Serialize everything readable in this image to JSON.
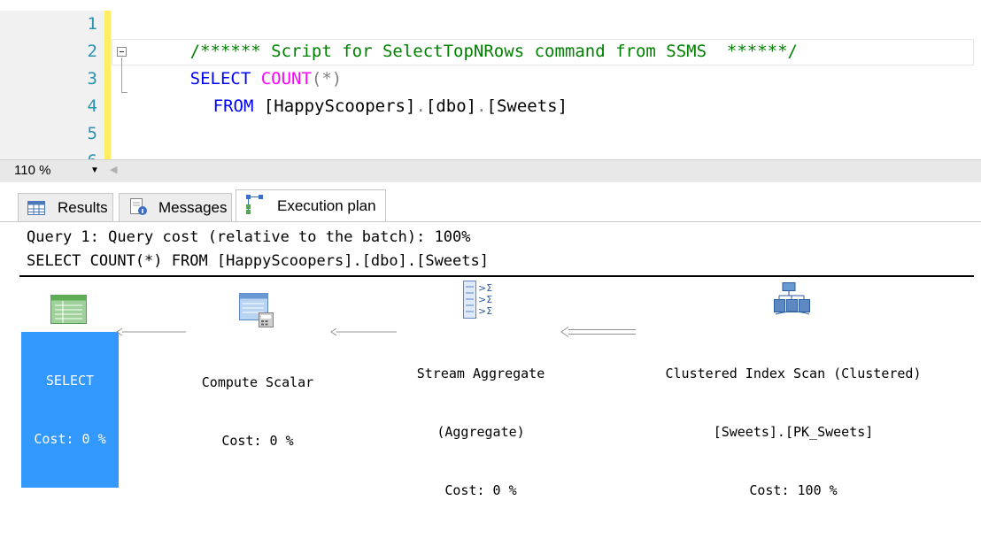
{
  "editor": {
    "lines": [
      {
        "num": "1",
        "segments": [
          {
            "cls": "c-comment",
            "text": "/****** Script for SelectTopNRows command from SSMS  ******/"
          }
        ]
      },
      {
        "num": "2",
        "segments": [
          {
            "cls": "c-kw",
            "text": "SELECT "
          },
          {
            "cls": "c-fn",
            "text": "COUNT"
          },
          {
            "cls": "c-op",
            "text": "(*)"
          }
        ]
      },
      {
        "num": "3",
        "segments": [
          {
            "cls": "c-kw",
            "text": "FROM "
          },
          {
            "cls": "c-txt",
            "text": "[HappyScoopers]"
          },
          {
            "cls": "c-op",
            "text": "."
          },
          {
            "cls": "c-txt",
            "text": "[dbo]"
          },
          {
            "cls": "c-op",
            "text": "."
          },
          {
            "cls": "c-txt",
            "text": "[Sweets]"
          }
        ]
      },
      {
        "num": "4",
        "segments": []
      },
      {
        "num": "5",
        "segments": []
      },
      {
        "num": "6",
        "segments": []
      }
    ]
  },
  "zoom": {
    "value": "110 %"
  },
  "tabs": {
    "results": "Results",
    "messages": "Messages",
    "execution_plan": "Execution plan"
  },
  "query": {
    "cost_line": "Query 1: Query cost (relative to the batch): 100%",
    "statement": "SELECT COUNT(*) FROM [HappyScoopers].[dbo].[Sweets]"
  },
  "plan": {
    "select": {
      "name": "SELECT",
      "cost": "Cost: 0 %"
    },
    "compute_scalar": {
      "name": "Compute Scalar",
      "cost": "Cost: 0 %"
    },
    "stream_aggregate": {
      "name": "Stream Aggregate",
      "subtitle": "(Aggregate)",
      "cost": "Cost: 0 %"
    },
    "clustered_index_scan": {
      "name": "Clustered Index Scan (Clustered)",
      "object": "[Sweets].[PK_Sweets]",
      "cost": "Cost: 100 %"
    }
  },
  "colors": {
    "keyword": "#0000ff",
    "function": "#ff00ff",
    "comment": "#008000",
    "line_number": "#2b91af",
    "selected_node": "#3399ff"
  }
}
